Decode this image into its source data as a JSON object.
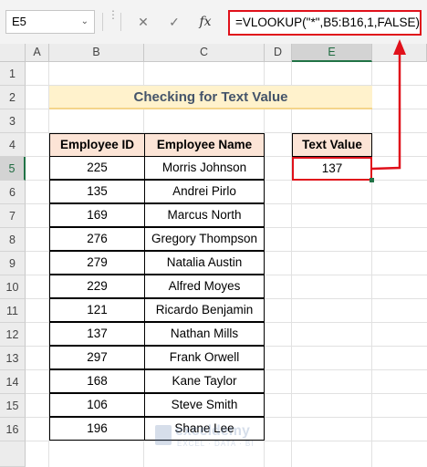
{
  "formula_bar": {
    "name_box": "E5",
    "cancel_icon": "✕",
    "enter_icon": "✓",
    "fx_label": "fx",
    "formula": "=VLOOKUP(\"*\",B5:B16,1,FALSE)"
  },
  "columns": [
    "A",
    "B",
    "C",
    "D",
    "E"
  ],
  "rows": [
    "1",
    "2",
    "3",
    "4",
    "5",
    "6",
    "7",
    "8",
    "9",
    "10",
    "11",
    "12",
    "13",
    "14",
    "15",
    "16"
  ],
  "title": "Checking for Text Value",
  "table": {
    "headers": [
      "Employee ID",
      "Employee Name"
    ],
    "rows": [
      [
        "225",
        "Morris Johnson"
      ],
      [
        "135",
        "Andrei Pirlo"
      ],
      [
        "169",
        "Marcus North"
      ],
      [
        "276",
        "Gregory Thompson"
      ],
      [
        "279",
        "Natalia Austin"
      ],
      [
        "229",
        "Alfred Moyes"
      ],
      [
        "121",
        "Ricardo Benjamin"
      ],
      [
        "137",
        "Nathan Mills"
      ],
      [
        "297",
        "Frank Orwell"
      ],
      [
        "168",
        "Kane Taylor"
      ],
      [
        "106",
        "Steve Smith"
      ],
      [
        "196",
        "Shane Lee"
      ]
    ]
  },
  "result": {
    "header": "Text Value",
    "value": "137"
  },
  "colors": {
    "highlight_red": "#e0101a",
    "header_fill": "#fce4d6",
    "title_fill": "#fff2cc",
    "excel_green": "#217346"
  },
  "watermark": {
    "name": "exceldemy",
    "tagline": "EXCEL · DATA · BI"
  }
}
